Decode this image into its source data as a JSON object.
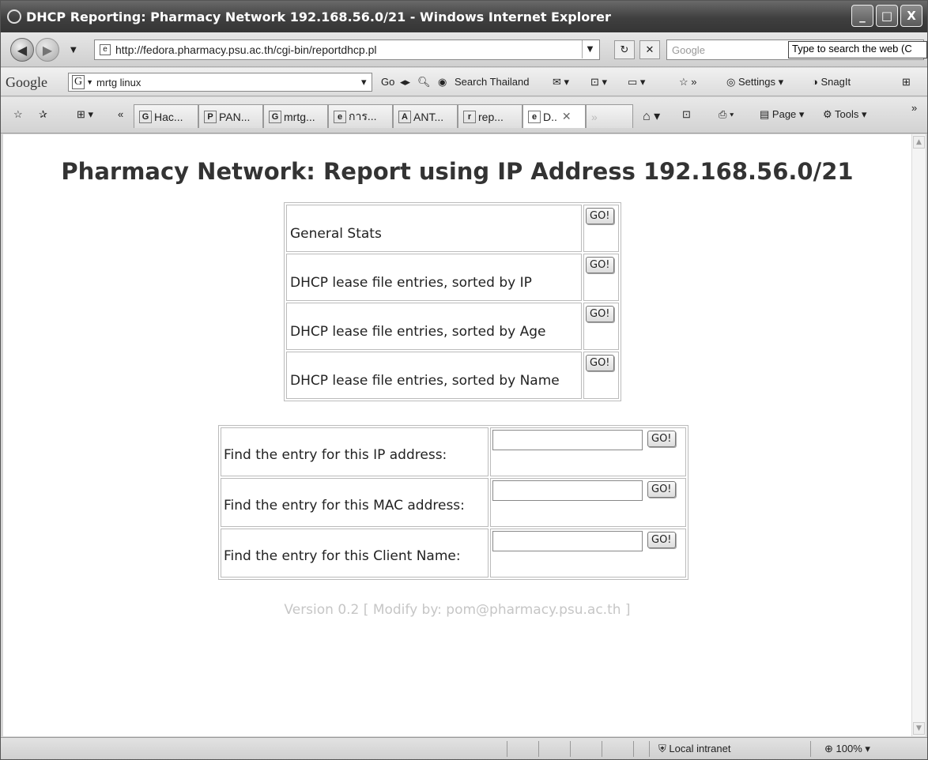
{
  "window": {
    "title": "DHCP Reporting: Pharmacy Network 192.168.56.0/21 - Windows Internet Explorer",
    "controls": [
      "_",
      "□",
      "X"
    ]
  },
  "address_bar": {
    "url": "http://fedora.pharmacy.psu.ac.th/cgi-bin/reportdhcp.pl",
    "search_placeholder": "Google",
    "tooltip": "Type to search the web (C"
  },
  "google_toolbar": {
    "logo": "Google",
    "query": "mrtg linux",
    "go_label": "Go",
    "search_country": "Search Thailand",
    "settings_label": "Settings",
    "snagit_label": "SnagIt"
  },
  "tabs": {
    "items": [
      {
        "label": "Hac...",
        "icon": "G"
      },
      {
        "label": "PAN...",
        "icon": "P"
      },
      {
        "label": "mrtg...",
        "icon": "G"
      },
      {
        "label": "การ...",
        "icon": "e"
      },
      {
        "label": "ANT...",
        "icon": "A"
      },
      {
        "label": "rep...",
        "icon": "r"
      },
      {
        "label": "D..",
        "icon": "e"
      }
    ],
    "page_menu": "Page",
    "tools_menu": "Tools"
  },
  "page": {
    "title": "Pharmacy Network: Report using IP Address 192.168.56.0/21",
    "reports": [
      "General Stats",
      "DHCP lease file entries, sorted by IP",
      "DHCP lease file entries, sorted by Age",
      "DHCP lease file entries, sorted by Name"
    ],
    "go_label": "GO!",
    "finders": [
      "Find the entry for this IP address:",
      "Find the entry for this MAC address:",
      "Find the entry for this Client Name:"
    ],
    "version": "Version 0.2 [ Modify by: pom@pharmacy.psu.ac.th ]"
  },
  "status_bar": {
    "zone": "Local intranet",
    "zoom": "100%"
  }
}
